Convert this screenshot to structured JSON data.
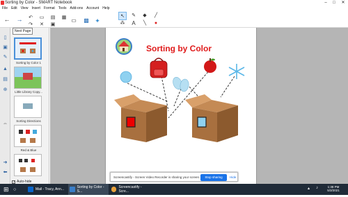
{
  "window": {
    "title": "Sorting by Color - SMART Notebook",
    "min": "–",
    "max": "□",
    "close": "✕"
  },
  "menu": [
    "File",
    "Edit",
    "View",
    "Insert",
    "Format",
    "Tools",
    "Add-ons",
    "Account",
    "Help"
  ],
  "tooltip": "Next Page",
  "sidebar": {
    "thumbs": [
      {
        "label": "Sorting by Color 1"
      },
      {
        "label": "Little Library Copy..."
      },
      {
        "label": "Sorting Directions"
      },
      {
        "label": "Red & Blue"
      },
      {
        "label": ""
      }
    ],
    "autohide_label": "Auto-hide"
  },
  "page": {
    "title": "Sorting by Color"
  },
  "share_bar": {
    "message": "Screencastify - Screen Video Recorder is sharing your screen.",
    "stop_label": "Stop sharing",
    "hide_label": "Hide"
  },
  "taskbar": {
    "tasks": [
      {
        "label": "Mail - Tracy, Ann...",
        "color": "#0a64c8"
      },
      {
        "label": "Sorting by Color - S...",
        "color": "#3a7ec8"
      },
      {
        "label": "Screencastify - Scre...",
        "color": "#e9a23b"
      }
    ],
    "time": "1:38 PM",
    "date": "5/3/2021"
  },
  "colors": {
    "title_red": "#e01b1b",
    "selection_blue": "#4a90d9"
  }
}
